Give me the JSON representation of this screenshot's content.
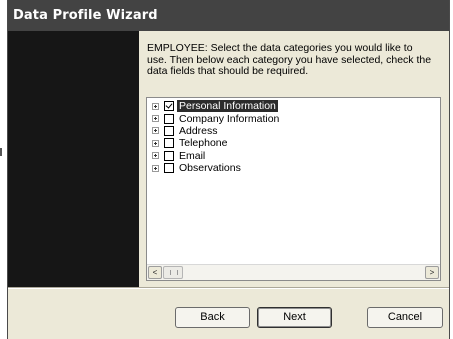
{
  "window": {
    "title": "Data Profile Wizard"
  },
  "instruction": "EMPLOYEE: Select the data categories you would like to use. Then below each category you have selected, check the data fields that should be required.",
  "categories": [
    {
      "label": "Personal Information",
      "checked": true,
      "selected": true
    },
    {
      "label": "Company Information",
      "checked": false,
      "selected": false
    },
    {
      "label": "Address",
      "checked": false,
      "selected": false
    },
    {
      "label": "Telephone",
      "checked": false,
      "selected": false
    },
    {
      "label": "Email",
      "checked": false,
      "selected": false
    },
    {
      "label": "Observations",
      "checked": false,
      "selected": false
    }
  ],
  "scrollbar": {
    "left_arrow": "<",
    "right_arrow": ">"
  },
  "buttons": {
    "back": "Back",
    "next": "Next",
    "cancel": "Cancel"
  }
}
